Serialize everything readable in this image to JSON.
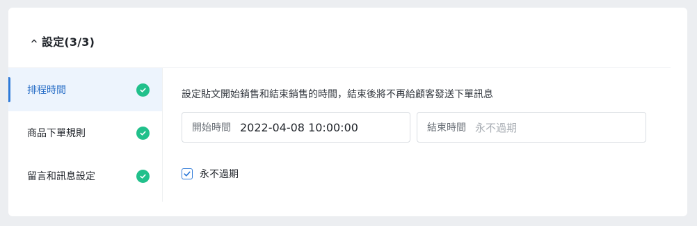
{
  "section": {
    "title": "設定(3/3)",
    "expanded": true,
    "chevron_icon": "chevron-up-icon"
  },
  "steps": [
    {
      "label": "排程時間",
      "active": true,
      "completed": true,
      "icon": "check-circle-icon"
    },
    {
      "label": "商品下單規則",
      "active": false,
      "completed": true,
      "icon": "check-circle-icon"
    },
    {
      "label": "留言和訊息設定",
      "active": false,
      "completed": true,
      "icon": "check-circle-icon"
    }
  ],
  "schedule": {
    "description": "設定貼文開始銷售和結束銷售的時間，結束後將不再給顧客發送下單訊息",
    "start": {
      "label": "開始時間",
      "value": "2022-04-08 10:00:00"
    },
    "end": {
      "label": "結束時間",
      "placeholder": "永不過期",
      "value": ""
    },
    "never_expire": {
      "label": "永不過期",
      "checked": true
    }
  },
  "colors": {
    "accent": "#2f7ad8",
    "active_bg": "#edf4fd",
    "success": "#21c08b",
    "page_bg": "#eceef1",
    "card_bg": "#ffffff"
  }
}
